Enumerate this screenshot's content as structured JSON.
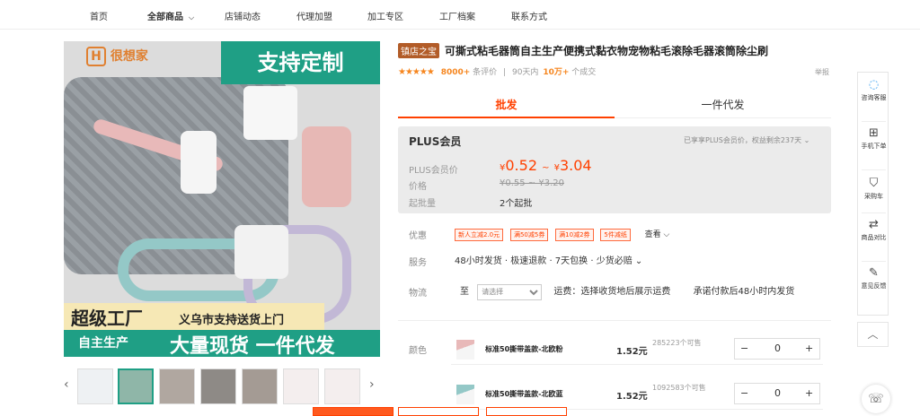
{
  "nav": {
    "items": [
      "首页",
      "全部商品",
      "店铺动态",
      "代理加盟",
      "加工专区",
      "工厂档案",
      "联系方式"
    ]
  },
  "gallery": {
    "logo_text": "很想家",
    "banner_top": "支持定制",
    "text_super": "超级工厂",
    "text_yiwu": "义乌市支持送货上门",
    "text_self": "自主生产",
    "text_stock": "大量现货 一件代发",
    "prev_icon": "chevron-left",
    "next_icon": "chevron-right"
  },
  "product": {
    "tag": "镇店之宝",
    "title": "可撕式粘毛器筒自主生产便携式黏衣物宠物粘毛滚除毛器滚筒除尘刷",
    "stars": "★★★★★",
    "reviews_count": "8000+",
    "reviews_label": "条评价",
    "sold_prefix": "90天内",
    "sold_count": "10万+",
    "sold_suffix": "个成交",
    "report": "举报"
  },
  "tabs": {
    "wholesale": "批发",
    "dropship": "一件代发"
  },
  "plus": {
    "title": "PLUS会员",
    "note": "已享享PLUS会员价，权益剩余237天 ⌄",
    "member_price_label": "PLUS会员价",
    "member_price_low": "0.52",
    "member_price_high": "3.04",
    "price_label": "价格",
    "price_value": "¥0.55 ~ ¥3.20",
    "moq_label": "起批量",
    "moq_value": "2个起批"
  },
  "promo": {
    "label": "优惠",
    "coupons": [
      "新人立减2.0元",
      "满50减5券",
      "满10减2券",
      "5件减纸"
    ],
    "view_more": "查看"
  },
  "service": {
    "label": "服务",
    "text": "48小时发货 · 极速退款 · 7天包换 · 少货必赔 ⌄"
  },
  "logistics": {
    "label": "物流",
    "to": "至",
    "select_placeholder": "请选择",
    "fee": "运费：选择收货地后展示运费",
    "promise": "承诺付款后48小时内发货"
  },
  "sku": {
    "label": "颜色",
    "rows": [
      {
        "name": "标准50撕带盖款-北欧粉",
        "price": "1.52元",
        "stock": "285223个可售",
        "qty": "0"
      },
      {
        "name": "标准50撕带盖款-北欧蓝",
        "price": "1.52元",
        "stock": "1092583个可售",
        "qty": "0"
      }
    ]
  },
  "rail": {
    "items": [
      {
        "icon": "chat-icon",
        "label": "咨询客服"
      },
      {
        "icon": "qrcode-icon",
        "label": "手机下单"
      },
      {
        "icon": "cart-icon",
        "label": "采购车"
      },
      {
        "icon": "compare-icon",
        "label": "商品对比"
      },
      {
        "icon": "feedback-icon",
        "label": "意见反馈"
      }
    ],
    "totop": "︿"
  },
  "colors": {
    "accent": "#ff4000",
    "green": "#1f9f85",
    "star": "#f6861f"
  }
}
